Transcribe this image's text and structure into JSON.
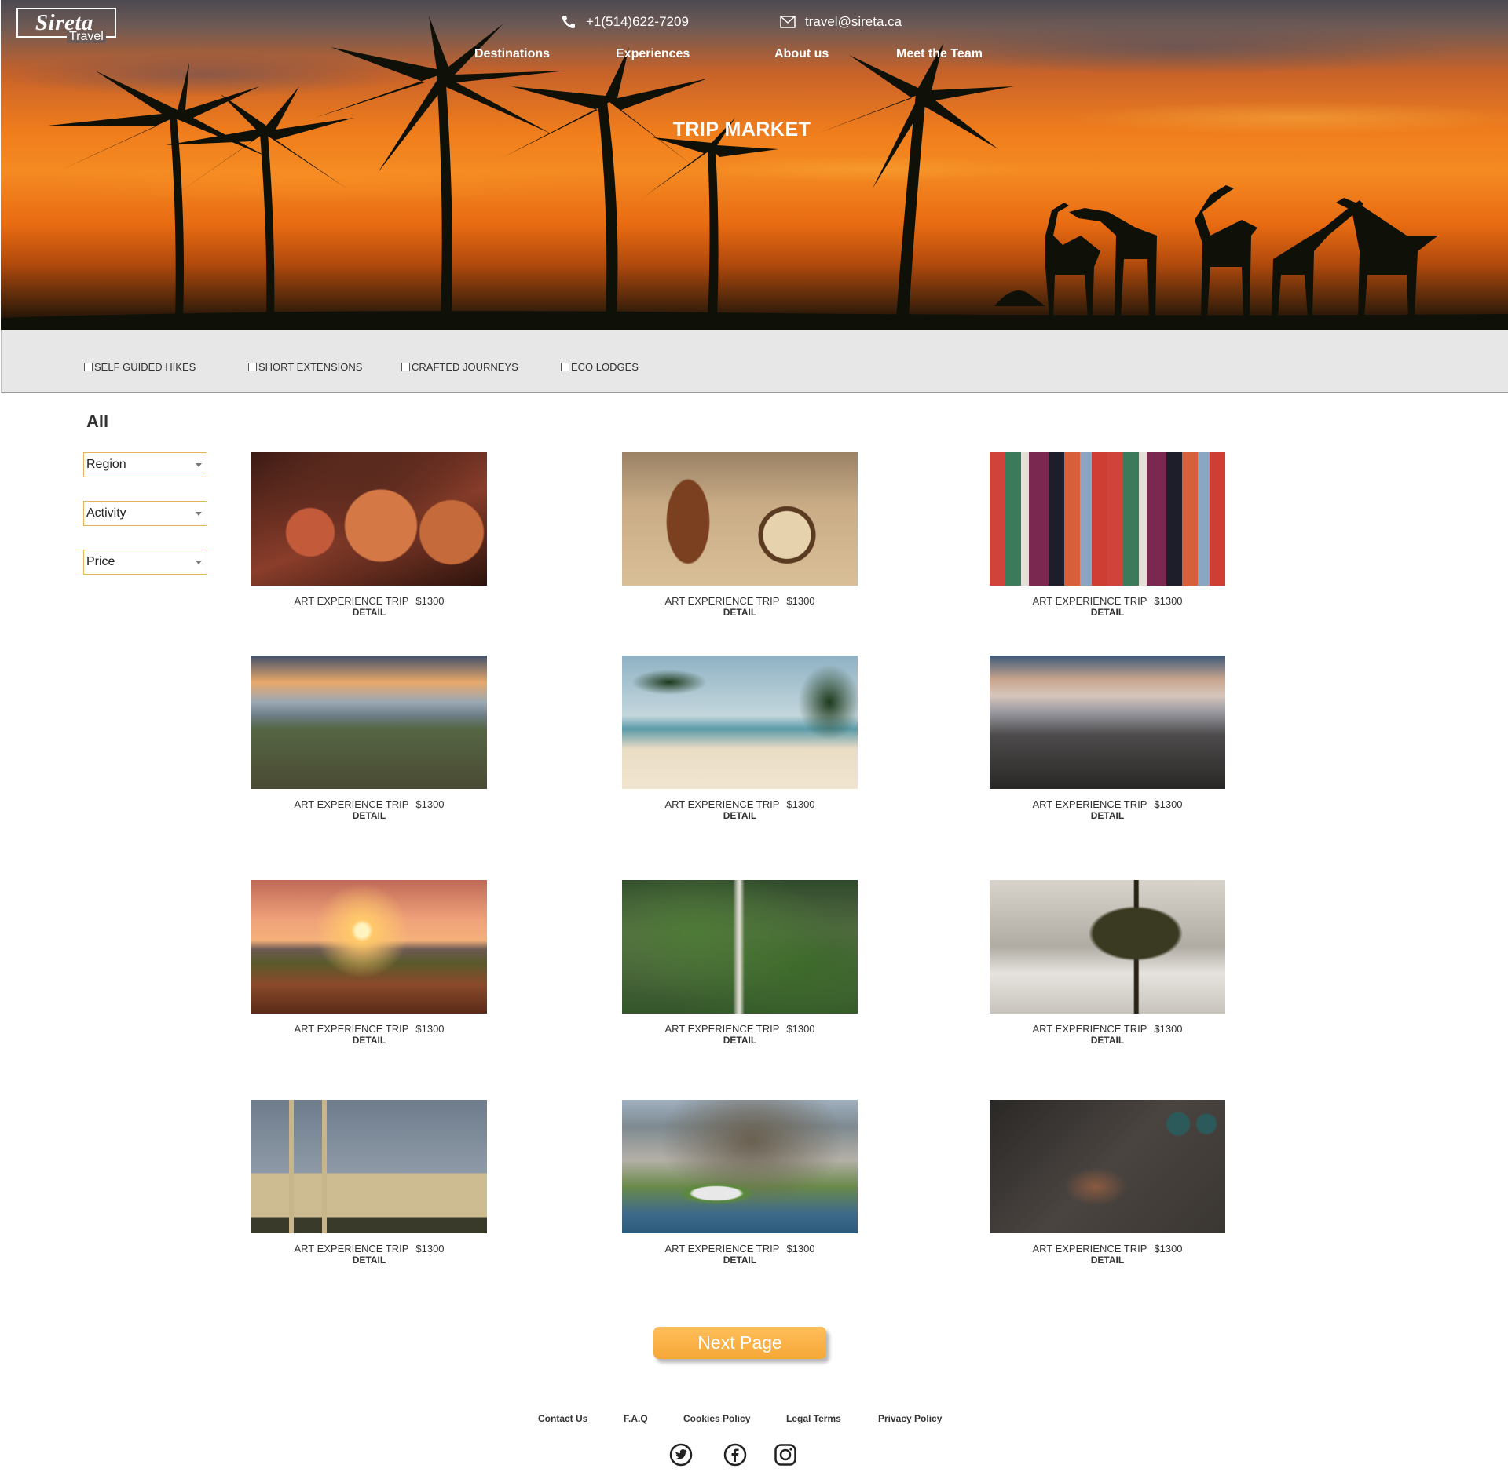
{
  "brand": {
    "name": "Sireta",
    "sub": "Travel"
  },
  "contact": {
    "phone": "+1(514)622-7209",
    "email": "travel@sireta.ca"
  },
  "nav": [
    "Destinations",
    "Experiences",
    "About us",
    "Meet the Team"
  ],
  "hero": {
    "title": "TRIP MARKET"
  },
  "categories": [
    "SELF GUIDED HIKES",
    "SHORT EXTENSIONS",
    "CRAFTED JOURNEYS",
    "ECO LODGES"
  ],
  "sidebar": {
    "title": "All",
    "filters": [
      "Region",
      "Activity",
      "Price"
    ]
  },
  "trips": [
    {
      "image": "woven-baskets",
      "name": "ART EXPERIENCE TRIP",
      "price": "$1300",
      "detail": "DETAIL"
    },
    {
      "image": "drums-on-sand",
      "name": "ART EXPERIENCE TRIP",
      "price": "$1300",
      "detail": "DETAIL"
    },
    {
      "image": "beaded-textile",
      "name": "ART EXPERIENCE TRIP",
      "price": "$1300",
      "detail": "DETAIL"
    },
    {
      "image": "penguin-beach",
      "name": "ART EXPERIENCE TRIP",
      "price": "$1300",
      "detail": "DETAIL"
    },
    {
      "image": "palm-beach",
      "name": "ART EXPERIENCE TRIP",
      "price": "$1300",
      "detail": "DETAIL"
    },
    {
      "image": "mountain-clouds",
      "name": "ART EXPERIENCE TRIP",
      "price": "$1300",
      "detail": "DETAIL"
    },
    {
      "image": "savanna-sunset",
      "name": "ART EXPERIENCE TRIP",
      "price": "$1300",
      "detail": "DETAIL"
    },
    {
      "image": "waterfall-forest",
      "name": "ART EXPERIENCE TRIP",
      "price": "$1300",
      "detail": "DETAIL"
    },
    {
      "image": "lone-tree",
      "name": "ART EXPERIENCE TRIP",
      "price": "$1300",
      "detail": "DETAIL"
    },
    {
      "image": "mosque",
      "name": "ART EXPERIENCE TRIP",
      "price": "$1300",
      "detail": "DETAIL"
    },
    {
      "image": "cape-town-aerial",
      "name": "ART EXPERIENCE TRIP",
      "price": "$1300",
      "detail": "DETAIL"
    },
    {
      "image": "artisan-hands",
      "name": "ART EXPERIENCE TRIP",
      "price": "$1300",
      "detail": "DETAIL"
    }
  ],
  "pagination": {
    "next_label": "Next Page"
  },
  "footer": {
    "links": [
      "Contact Us",
      "F.A.Q",
      "Cookies Policy",
      "Legal Terms",
      "Privacy Policy"
    ],
    "social": [
      "twitter-icon",
      "facebook-icon",
      "instagram-icon"
    ]
  },
  "colors": {
    "accent": "#f6a737",
    "filter_bar": "#e7e7e7",
    "dropdown_border": "#e6b35c"
  }
}
